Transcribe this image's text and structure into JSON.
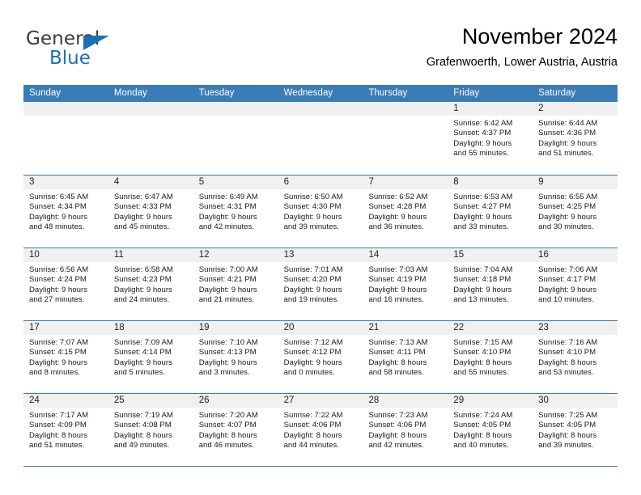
{
  "brand": {
    "name_part1": "General",
    "name_part2": "Blue",
    "triangle_color": "#1b71b8"
  },
  "header": {
    "title": "November 2024",
    "subtitle": "Grafenwoerth, Lower Austria, Austria"
  },
  "theme": {
    "header_blue": "#3a7cb8",
    "day_band_gray": "#f0f0f0",
    "text_color": "#000000"
  },
  "calendar": {
    "weekdays": [
      "Sunday",
      "Monday",
      "Tuesday",
      "Wednesday",
      "Thursday",
      "Friday",
      "Saturday"
    ],
    "weeks": [
      [
        {
          "day": "",
          "empty": true
        },
        {
          "day": "",
          "empty": true
        },
        {
          "day": "",
          "empty": true
        },
        {
          "day": "",
          "empty": true
        },
        {
          "day": "",
          "empty": true
        },
        {
          "day": "1",
          "sunrise": "Sunrise: 6:42 AM",
          "sunset": "Sunset: 4:37 PM",
          "daylight1": "Daylight: 9 hours",
          "daylight2": "and 55 minutes."
        },
        {
          "day": "2",
          "sunrise": "Sunrise: 6:44 AM",
          "sunset": "Sunset: 4:36 PM",
          "daylight1": "Daylight: 9 hours",
          "daylight2": "and 51 minutes."
        }
      ],
      [
        {
          "day": "3",
          "sunrise": "Sunrise: 6:45 AM",
          "sunset": "Sunset: 4:34 PM",
          "daylight1": "Daylight: 9 hours",
          "daylight2": "and 48 minutes."
        },
        {
          "day": "4",
          "sunrise": "Sunrise: 6:47 AM",
          "sunset": "Sunset: 4:33 PM",
          "daylight1": "Daylight: 9 hours",
          "daylight2": "and 45 minutes."
        },
        {
          "day": "5",
          "sunrise": "Sunrise: 6:49 AM",
          "sunset": "Sunset: 4:31 PM",
          "daylight1": "Daylight: 9 hours",
          "daylight2": "and 42 minutes."
        },
        {
          "day": "6",
          "sunrise": "Sunrise: 6:50 AM",
          "sunset": "Sunset: 4:30 PM",
          "daylight1": "Daylight: 9 hours",
          "daylight2": "and 39 minutes."
        },
        {
          "day": "7",
          "sunrise": "Sunrise: 6:52 AM",
          "sunset": "Sunset: 4:28 PM",
          "daylight1": "Daylight: 9 hours",
          "daylight2": "and 36 minutes."
        },
        {
          "day": "8",
          "sunrise": "Sunrise: 6:53 AM",
          "sunset": "Sunset: 4:27 PM",
          "daylight1": "Daylight: 9 hours",
          "daylight2": "and 33 minutes."
        },
        {
          "day": "9",
          "sunrise": "Sunrise: 6:55 AM",
          "sunset": "Sunset: 4:25 PM",
          "daylight1": "Daylight: 9 hours",
          "daylight2": "and 30 minutes."
        }
      ],
      [
        {
          "day": "10",
          "sunrise": "Sunrise: 6:56 AM",
          "sunset": "Sunset: 4:24 PM",
          "daylight1": "Daylight: 9 hours",
          "daylight2": "and 27 minutes."
        },
        {
          "day": "11",
          "sunrise": "Sunrise: 6:58 AM",
          "sunset": "Sunset: 4:23 PM",
          "daylight1": "Daylight: 9 hours",
          "daylight2": "and 24 minutes."
        },
        {
          "day": "12",
          "sunrise": "Sunrise: 7:00 AM",
          "sunset": "Sunset: 4:21 PM",
          "daylight1": "Daylight: 9 hours",
          "daylight2": "and 21 minutes."
        },
        {
          "day": "13",
          "sunrise": "Sunrise: 7:01 AM",
          "sunset": "Sunset: 4:20 PM",
          "daylight1": "Daylight: 9 hours",
          "daylight2": "and 19 minutes."
        },
        {
          "day": "14",
          "sunrise": "Sunrise: 7:03 AM",
          "sunset": "Sunset: 4:19 PM",
          "daylight1": "Daylight: 9 hours",
          "daylight2": "and 16 minutes."
        },
        {
          "day": "15",
          "sunrise": "Sunrise: 7:04 AM",
          "sunset": "Sunset: 4:18 PM",
          "daylight1": "Daylight: 9 hours",
          "daylight2": "and 13 minutes."
        },
        {
          "day": "16",
          "sunrise": "Sunrise: 7:06 AM",
          "sunset": "Sunset: 4:17 PM",
          "daylight1": "Daylight: 9 hours",
          "daylight2": "and 10 minutes."
        }
      ],
      [
        {
          "day": "17",
          "sunrise": "Sunrise: 7:07 AM",
          "sunset": "Sunset: 4:15 PM",
          "daylight1": "Daylight: 9 hours",
          "daylight2": "and 8 minutes."
        },
        {
          "day": "18",
          "sunrise": "Sunrise: 7:09 AM",
          "sunset": "Sunset: 4:14 PM",
          "daylight1": "Daylight: 9 hours",
          "daylight2": "and 5 minutes."
        },
        {
          "day": "19",
          "sunrise": "Sunrise: 7:10 AM",
          "sunset": "Sunset: 4:13 PM",
          "daylight1": "Daylight: 9 hours",
          "daylight2": "and 3 minutes."
        },
        {
          "day": "20",
          "sunrise": "Sunrise: 7:12 AM",
          "sunset": "Sunset: 4:12 PM",
          "daylight1": "Daylight: 9 hours",
          "daylight2": "and 0 minutes."
        },
        {
          "day": "21",
          "sunrise": "Sunrise: 7:13 AM",
          "sunset": "Sunset: 4:11 PM",
          "daylight1": "Daylight: 8 hours",
          "daylight2": "and 58 minutes."
        },
        {
          "day": "22",
          "sunrise": "Sunrise: 7:15 AM",
          "sunset": "Sunset: 4:10 PM",
          "daylight1": "Daylight: 8 hours",
          "daylight2": "and 55 minutes."
        },
        {
          "day": "23",
          "sunrise": "Sunrise: 7:16 AM",
          "sunset": "Sunset: 4:10 PM",
          "daylight1": "Daylight: 8 hours",
          "daylight2": "and 53 minutes."
        }
      ],
      [
        {
          "day": "24",
          "sunrise": "Sunrise: 7:17 AM",
          "sunset": "Sunset: 4:09 PM",
          "daylight1": "Daylight: 8 hours",
          "daylight2": "and 51 minutes."
        },
        {
          "day": "25",
          "sunrise": "Sunrise: 7:19 AM",
          "sunset": "Sunset: 4:08 PM",
          "daylight1": "Daylight: 8 hours",
          "daylight2": "and 49 minutes."
        },
        {
          "day": "26",
          "sunrise": "Sunrise: 7:20 AM",
          "sunset": "Sunset: 4:07 PM",
          "daylight1": "Daylight: 8 hours",
          "daylight2": "and 46 minutes."
        },
        {
          "day": "27",
          "sunrise": "Sunrise: 7:22 AM",
          "sunset": "Sunset: 4:06 PM",
          "daylight1": "Daylight: 8 hours",
          "daylight2": "and 44 minutes."
        },
        {
          "day": "28",
          "sunrise": "Sunrise: 7:23 AM",
          "sunset": "Sunset: 4:06 PM",
          "daylight1": "Daylight: 8 hours",
          "daylight2": "and 42 minutes."
        },
        {
          "day": "29",
          "sunrise": "Sunrise: 7:24 AM",
          "sunset": "Sunset: 4:05 PM",
          "daylight1": "Daylight: 8 hours",
          "daylight2": "and 40 minutes."
        },
        {
          "day": "30",
          "sunrise": "Sunrise: 7:25 AM",
          "sunset": "Sunset: 4:05 PM",
          "daylight1": "Daylight: 8 hours",
          "daylight2": "and 39 minutes."
        }
      ]
    ]
  }
}
